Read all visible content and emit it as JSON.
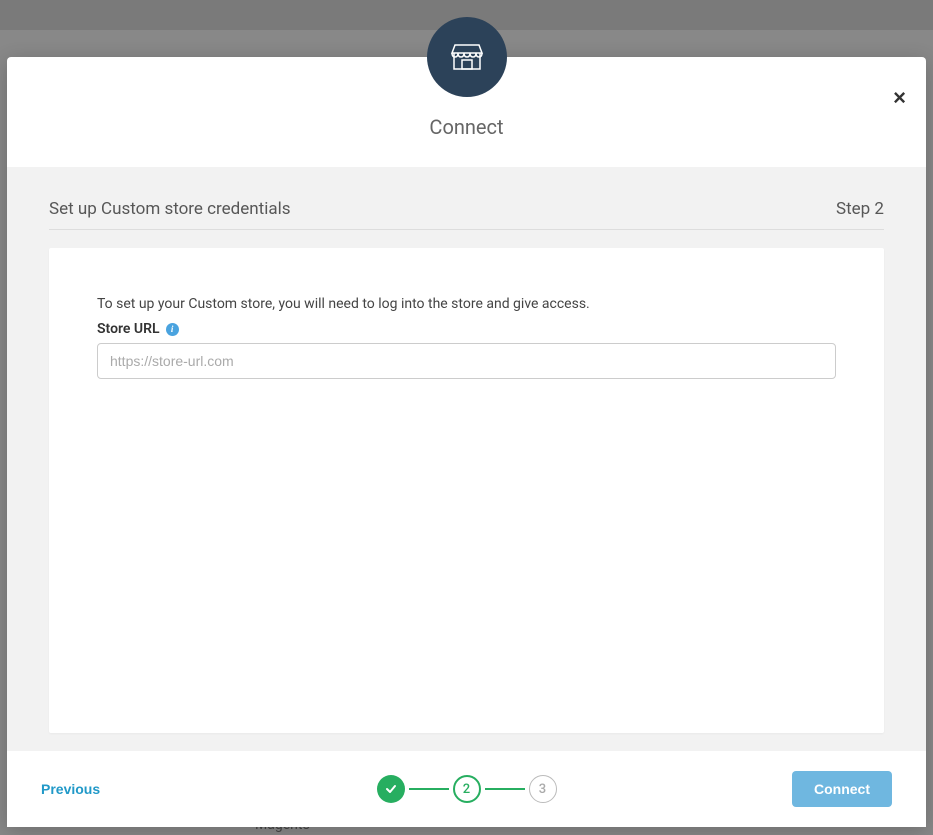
{
  "modal": {
    "title": "Connect",
    "close_label": "×"
  },
  "section": {
    "heading": "Set up Custom store credentials",
    "step_indicator": "Step 2"
  },
  "form": {
    "instruction": "To set up your Custom store, you will need to log into the store and give access.",
    "url_label": "Store URL",
    "url_placeholder": "https://store-url.com"
  },
  "footer": {
    "previous_label": "Previous",
    "connect_label": "Connect"
  },
  "stepper": {
    "step1_check": "✓",
    "step2_label": "2",
    "step3_label": "3"
  },
  "background": {
    "text1": "Magento"
  }
}
